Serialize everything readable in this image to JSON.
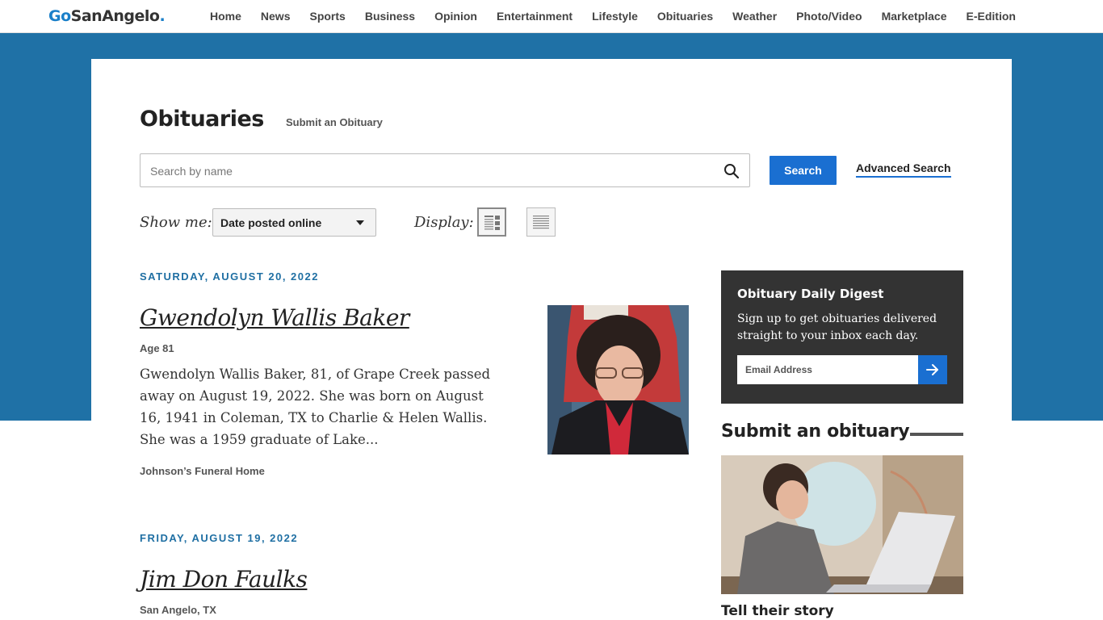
{
  "site": {
    "logo_go": "Go",
    "logo_rest": "SanAngelo",
    "logo_dot": "."
  },
  "nav": {
    "items": [
      {
        "label": "Home"
      },
      {
        "label": "News"
      },
      {
        "label": "Sports"
      },
      {
        "label": "Business"
      },
      {
        "label": "Opinion"
      },
      {
        "label": "Entertainment"
      },
      {
        "label": "Lifestyle"
      },
      {
        "label": "Obituaries"
      },
      {
        "label": "Weather"
      },
      {
        "label": "Photo/Video"
      },
      {
        "label": "Marketplace"
      },
      {
        "label": "E-Edition"
      }
    ]
  },
  "header": {
    "title": "Obituaries",
    "submit_link": "Submit an Obituary"
  },
  "search": {
    "placeholder": "Search by name",
    "value": "",
    "button_label": "Search",
    "advanced_label": "Advanced Search"
  },
  "filters": {
    "show_me_label": "Show me:",
    "sort_selected": "Date posted online",
    "display_label": "Display:"
  },
  "obituaries": [
    {
      "date": "SATURDAY, AUGUST 20, 2022",
      "name": "Gwendolyn Wallis Baker",
      "subtitle": "Age 81",
      "excerpt": "Gwendolyn Wallis Baker, 81, of Grape Creek passed away on August 19, 2022. She was born on August 16, 1941 in Coleman, TX to Charlie & Helen Wallis. She was a 1959 graduate of Lake...",
      "funeral_home": "Johnson’s Funeral Home"
    },
    {
      "date": "FRIDAY, AUGUST 19, 2022",
      "name": "Jim Don Faulks",
      "subtitle": "San Angelo, TX"
    }
  ],
  "digest": {
    "title": "Obituary Daily Digest",
    "description": "Sign up to get obituaries delivered straight to your inbox each day.",
    "email_placeholder": "Email Address"
  },
  "submit_promo": {
    "heading": "Submit an obituary",
    "caption": "Tell their story"
  },
  "colors": {
    "brand_blue": "#1f71a6",
    "button_blue": "#1a6fd1",
    "digest_bg": "#333333"
  }
}
